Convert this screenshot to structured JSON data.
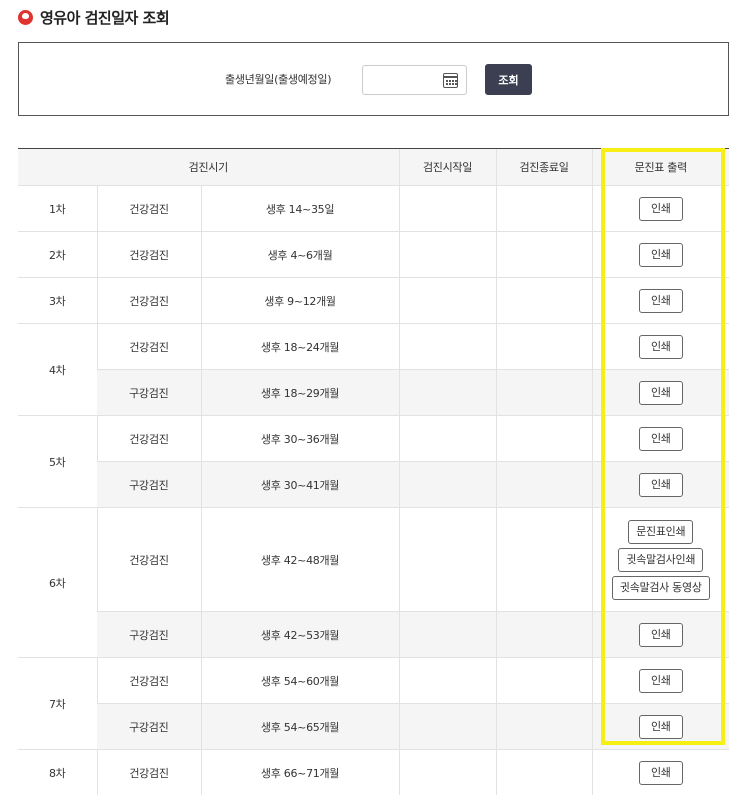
{
  "page": {
    "title": "영유아 검진일자 조회"
  },
  "search": {
    "label": "출생년월일(출생예정일)",
    "date_value": "",
    "button": "조회"
  },
  "table": {
    "headers": {
      "period": "검진시기",
      "start": "검진시작일",
      "end": "검진종료일",
      "print": "문진표 출력"
    },
    "rows": [
      {
        "round": "1차",
        "type": "건강검진",
        "age": "생후 14~35일",
        "start": "",
        "end": "",
        "buttons": [
          "인쇄"
        ]
      },
      {
        "round": "2차",
        "type": "건강검진",
        "age": "생후 4~6개월",
        "start": "",
        "end": "",
        "buttons": [
          "인쇄"
        ]
      },
      {
        "round": "3차",
        "type": "건강검진",
        "age": "생후 9~12개월",
        "start": "",
        "end": "",
        "buttons": [
          "인쇄"
        ]
      },
      {
        "round": "4차",
        "type": "건강검진",
        "age": "생후 18~24개월",
        "start": "",
        "end": "",
        "buttons": [
          "인쇄"
        ]
      },
      {
        "round": "",
        "type": "구강검진",
        "age": "생후 18~29개월",
        "start": "",
        "end": "",
        "buttons": [
          "인쇄"
        ]
      },
      {
        "round": "5차",
        "type": "건강검진",
        "age": "생후 30~36개월",
        "start": "",
        "end": "",
        "buttons": [
          "인쇄"
        ]
      },
      {
        "round": "",
        "type": "구강검진",
        "age": "생후 30~41개월",
        "start": "",
        "end": "",
        "buttons": [
          "인쇄"
        ]
      },
      {
        "round": "6차",
        "type": "건강검진",
        "age": "생후 42~48개월",
        "start": "",
        "end": "",
        "buttons": [
          "문진표인쇄",
          "귓속말검사인쇄",
          "귓속말검사 동영상"
        ]
      },
      {
        "round": "",
        "type": "구강검진",
        "age": "생후 42~53개월",
        "start": "",
        "end": "",
        "buttons": [
          "인쇄"
        ]
      },
      {
        "round": "7차",
        "type": "건강검진",
        "age": "생후 54~60개월",
        "start": "",
        "end": "",
        "buttons": [
          "인쇄"
        ]
      },
      {
        "round": "",
        "type": "구강검진",
        "age": "생후 54~65개월",
        "start": "",
        "end": "",
        "buttons": [
          "인쇄"
        ]
      },
      {
        "round": "8차",
        "type": "건강검진",
        "age": "생후 66~71개월",
        "start": "",
        "end": "",
        "buttons": [
          "인쇄"
        ]
      }
    ]
  },
  "colors": {
    "highlight": "#f7ef14",
    "search_button": "#3b3f51",
    "title_icon": "#e0332f"
  }
}
